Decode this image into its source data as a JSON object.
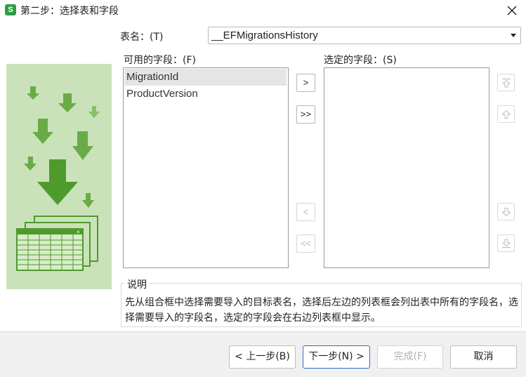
{
  "window": {
    "title": "第二步：选择表和字段",
    "app_icon_letter": "S"
  },
  "table_picker": {
    "label": "表名：(T)",
    "value": "__EFMigrationsHistory"
  },
  "available_fields": {
    "label": "可用的字段：(F)",
    "items": [
      "MigrationId",
      "ProductVersion"
    ]
  },
  "selected_fields": {
    "label": "选定的字段：(S)",
    "items": []
  },
  "move_buttons": {
    "add": ">",
    "add_all": ">>",
    "remove": "<",
    "remove_all": "<<"
  },
  "description": {
    "legend": "说明",
    "text": "先从组合框中选择需要导入的目标表名，选择后左边的列表框会列出表中所有的字段名，选择需要导入的字段名，选定的字段会在右边列表框中显示。"
  },
  "footer": {
    "back": "< 上一步(B)",
    "next": "下一步(N) >",
    "finish": "完成(F)",
    "cancel": "取消"
  },
  "colors": {
    "art_bg": "#c9e2b9",
    "art_dark": "#4f9a2c",
    "art_light": "#8cc46e",
    "primary_border": "#2a6ecb"
  }
}
